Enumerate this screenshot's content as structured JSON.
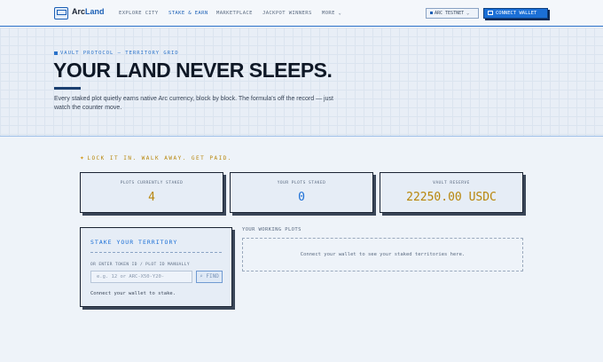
{
  "nav": {
    "brand_a": "Arc",
    "brand_b": "Land",
    "items": [
      "EXPLORE CITY",
      "STAKE & EARN",
      "MARKETPLACE",
      "JACKPOT WINNERS",
      "MORE ⌄"
    ],
    "network": "ARC TESTNET ⌄",
    "connect": "CONNECT WALLET"
  },
  "hero": {
    "eyebrow": "VAULT PROTOCOL — TERRITORY GRID",
    "headline": "YOUR LAND NEVER SLEEPS.",
    "subtitle": "Every staked plot quietly earns native Arc currency, block by block. The formula's off the record — just watch the counter move."
  },
  "tagline": "LOCK IT IN. WALK AWAY. GET PAID.",
  "stats": [
    {
      "label": "PLOTS CURRENTLY STAKED",
      "value": "4"
    },
    {
      "label": "YOUR PLOTS STAKED",
      "value": "0"
    },
    {
      "label": "VAULT RESERVE",
      "value": "22250.00 USDC"
    }
  ],
  "stake": {
    "title": "STAKE YOUR TERRITORY",
    "hint": "OR ENTER TOKEN ID / PLOT ID MANUALLY",
    "placeholder": "e.g. 12 or ARC-X50-Y20-",
    "find": "FIND",
    "note": "Connect your wallet to stake."
  },
  "working": {
    "title": "YOUR WORKING PLOTS",
    "empty": "Connect your wallet to see your staked territories here."
  },
  "colors": {
    "accent": "#1b6fd6",
    "gold": "#b8860b",
    "ink": "#0f1826"
  }
}
